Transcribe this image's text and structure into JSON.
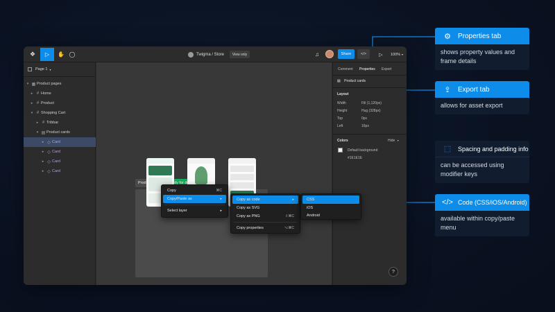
{
  "toolbar": {
    "breadcrumb": "Twigma / Store",
    "view_only_label": "View only",
    "share_label": "Share",
    "code_label": "</>",
    "zoom_label": "100%"
  },
  "left_panel": {
    "page_label": "Page 1",
    "layers": [
      {
        "label": "Product pages",
        "depth": 0
      },
      {
        "label": "Home",
        "depth": 1
      },
      {
        "label": "Product",
        "depth": 1
      },
      {
        "label": "Shopping Cart",
        "depth": 1
      },
      {
        "label": "Tribbar",
        "depth": 2
      },
      {
        "label": "Product cards",
        "depth": 2
      },
      {
        "label": "Card",
        "depth": 3
      },
      {
        "label": "Card",
        "depth": 3
      },
      {
        "label": "Card",
        "depth": 3
      },
      {
        "label": "Card",
        "depth": 3
      }
    ]
  },
  "canvas": {
    "frame_label": "Product pages",
    "ready_label": "Ready for dev",
    "ready_count": "1/4",
    "screen_labels": [
      "Home",
      "Product",
      "Shopping cart"
    ],
    "help_label": "?"
  },
  "right_panel": {
    "tabs": [
      "Comment",
      "Properties",
      "Export"
    ],
    "component_label": "Product cards",
    "layout_title": "Layout",
    "layout_rows": [
      {
        "key": "Width",
        "value": "Fill (1,120px)"
      },
      {
        "key": "Height",
        "value": "Hug (328px)"
      },
      {
        "key": "Top",
        "value": "0px"
      },
      {
        "key": "Left",
        "value": "16px"
      }
    ],
    "colors_title": "Colors",
    "hide_label": "Hide",
    "color_name": "Default background",
    "color_hex": "#1E1E1E"
  },
  "context_menu": {
    "items": [
      {
        "label": "Copy",
        "shortcut": "⌘C"
      },
      {
        "label": "Copy/Paste as",
        "shortcut": "▸"
      },
      {
        "label": "Select layer",
        "shortcut": "▸"
      }
    ]
  },
  "submenu": {
    "items": [
      {
        "label": "Copy as code",
        "shortcut": "▸"
      },
      {
        "label": "Copy as SVG",
        "shortcut": ""
      },
      {
        "label": "Copy as PNG",
        "shortcut": "⇧⌘C"
      },
      {
        "label": "Copy properties",
        "shortcut": "⌥⌘C"
      }
    ]
  },
  "code_menu": {
    "items": [
      "CSS",
      "iOS",
      "Android"
    ]
  },
  "callouts": [
    {
      "title": "Properties tab",
      "body": "shows property values and frame details",
      "icon": "gear-icon",
      "style": "blue"
    },
    {
      "title": "Export tab",
      "body": "allows for asset export",
      "icon": "export-icon",
      "style": "blue"
    },
    {
      "title": "Spacing and padding info",
      "body": "can be accessed using modifier keys",
      "icon": "spacing-icon",
      "style": "dark"
    },
    {
      "title": "Code (CSS/iOS/Android)",
      "body": "available within copy/paste menu",
      "icon": "code-icon",
      "style": "blue"
    }
  ],
  "colors": {
    "accent": "#0d8ce9",
    "ready_green": "#14ae5c",
    "background": "#0a1222",
    "panel": "#2c2c2c",
    "canvas": "#383838"
  }
}
